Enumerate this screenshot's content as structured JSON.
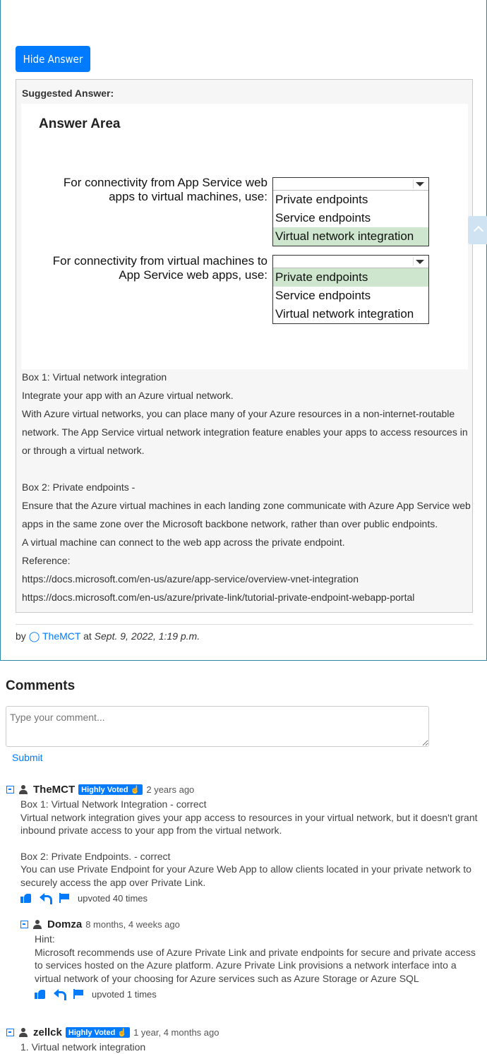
{
  "question": {
    "hide_answer_label": "Hide Answer",
    "suggested_answer_label": "Suggested Answer:",
    "answer_area": {
      "title": "Answer Area",
      "q1": {
        "line1": "For connectivity from App Service web",
        "line2": "apps to virtual machines, use:",
        "options": [
          "Private endpoints",
          "Service endpoints",
          "Virtual network integration"
        ],
        "selected_index": 2
      },
      "q2": {
        "line1": "For connectivity from virtual machines to",
        "line2": "App Service web apps, use:",
        "options": [
          "Private endpoints",
          "Service endpoints",
          "Virtual network integration"
        ],
        "selected_index": 0
      },
      "selected_color": "#cde6cd"
    },
    "explanation": [
      "Box 1: Virtual network integration",
      "Integrate your app with an Azure virtual network.",
      "With Azure virtual networks, you can place many of your Azure resources in a non-internet-routable network. The App Service virtual network integration feature enables your apps to access resources in or through a virtual network.",
      "",
      "Box 2: Private endpoints -",
      "Ensure that the Azure virtual machines in each landing zone communicate with Azure App Service web apps in the same zone over the Microsoft backbone network, rather than over public endpoints.",
      "A virtual machine can connect to the web app across the private endpoint.",
      "Reference:",
      "https://docs.microsoft.com/en-us/azure/app-service/overview-vnet-integration",
      "https://docs.microsoft.com/en-us/azure/private-link/tutorial-private-endpoint-webapp-portal"
    ],
    "byline": {
      "by": "by",
      "user": "TheMCT",
      "at": "at",
      "date": "Sept. 9, 2022, 1:19 p.m."
    }
  },
  "comments_section": {
    "title": "Comments",
    "input_placeholder": "Type your comment...",
    "submit_label": "Submit",
    "comments": [
      {
        "user": "TheMCT",
        "badge": "Highly Voted",
        "ago": "2 years ago",
        "body": [
          "Box 1: Virtual Network Integration - correct",
          "Virtual network integration gives your app access to resources in your virtual network, but it doesn't grant inbound private access to your app from the virtual network.",
          "",
          "Box 2: Private Endpoints. - correct",
          "You can use Private Endpoint for your Azure Web App to allow clients located in your private network to securely access the app over Private Link."
        ],
        "votes": "upvoted 40 times"
      },
      {
        "user": "Domza",
        "badge": "",
        "ago": "8 months, 4 weeks ago",
        "body": [
          "Hint:",
          "Microsoft recommends use of Azure Private Link and private endpoints for secure and private access to services hosted on the Azure platform. Azure Private Link provisions a network interface into a virtual network of your choosing for Azure services such as Azure Storage or Azure SQL"
        ],
        "votes": "upvoted 1 times"
      },
      {
        "user": "zellck",
        "badge": "Highly Voted",
        "ago": "1 year, 4 months ago",
        "body": [
          "1. Virtual network integration"
        ],
        "votes": ""
      }
    ]
  },
  "colors": {
    "accent": "#007bff",
    "card_border": "#2a8aa6"
  }
}
